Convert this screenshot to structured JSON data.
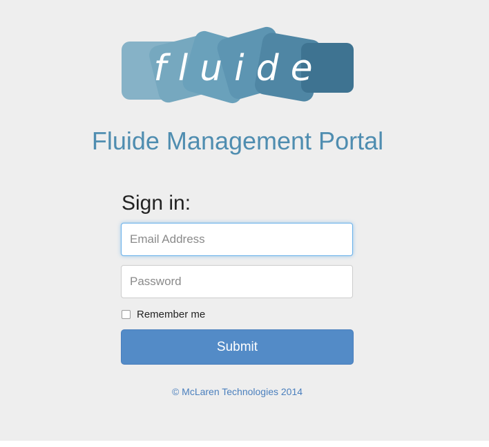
{
  "logo": {
    "text": "fluide",
    "colors": [
      "#86b2c7",
      "#76a8bf",
      "#6aa1bb",
      "#5d95b2",
      "#4f86a4",
      "#3e7391"
    ]
  },
  "header": {
    "title": "Fluide Management Portal"
  },
  "form": {
    "heading": "Sign in:",
    "email_placeholder": "Email Address",
    "password_placeholder": "Password",
    "remember_label": "Remember me",
    "remember_checked": false,
    "submit_label": "Submit"
  },
  "footer": {
    "copyright": "© McLaren Technologies 2014"
  },
  "colors": {
    "background": "#eeeeee",
    "title": "#4f8db0",
    "button": "#538bc7",
    "link": "#4a7fbd"
  }
}
